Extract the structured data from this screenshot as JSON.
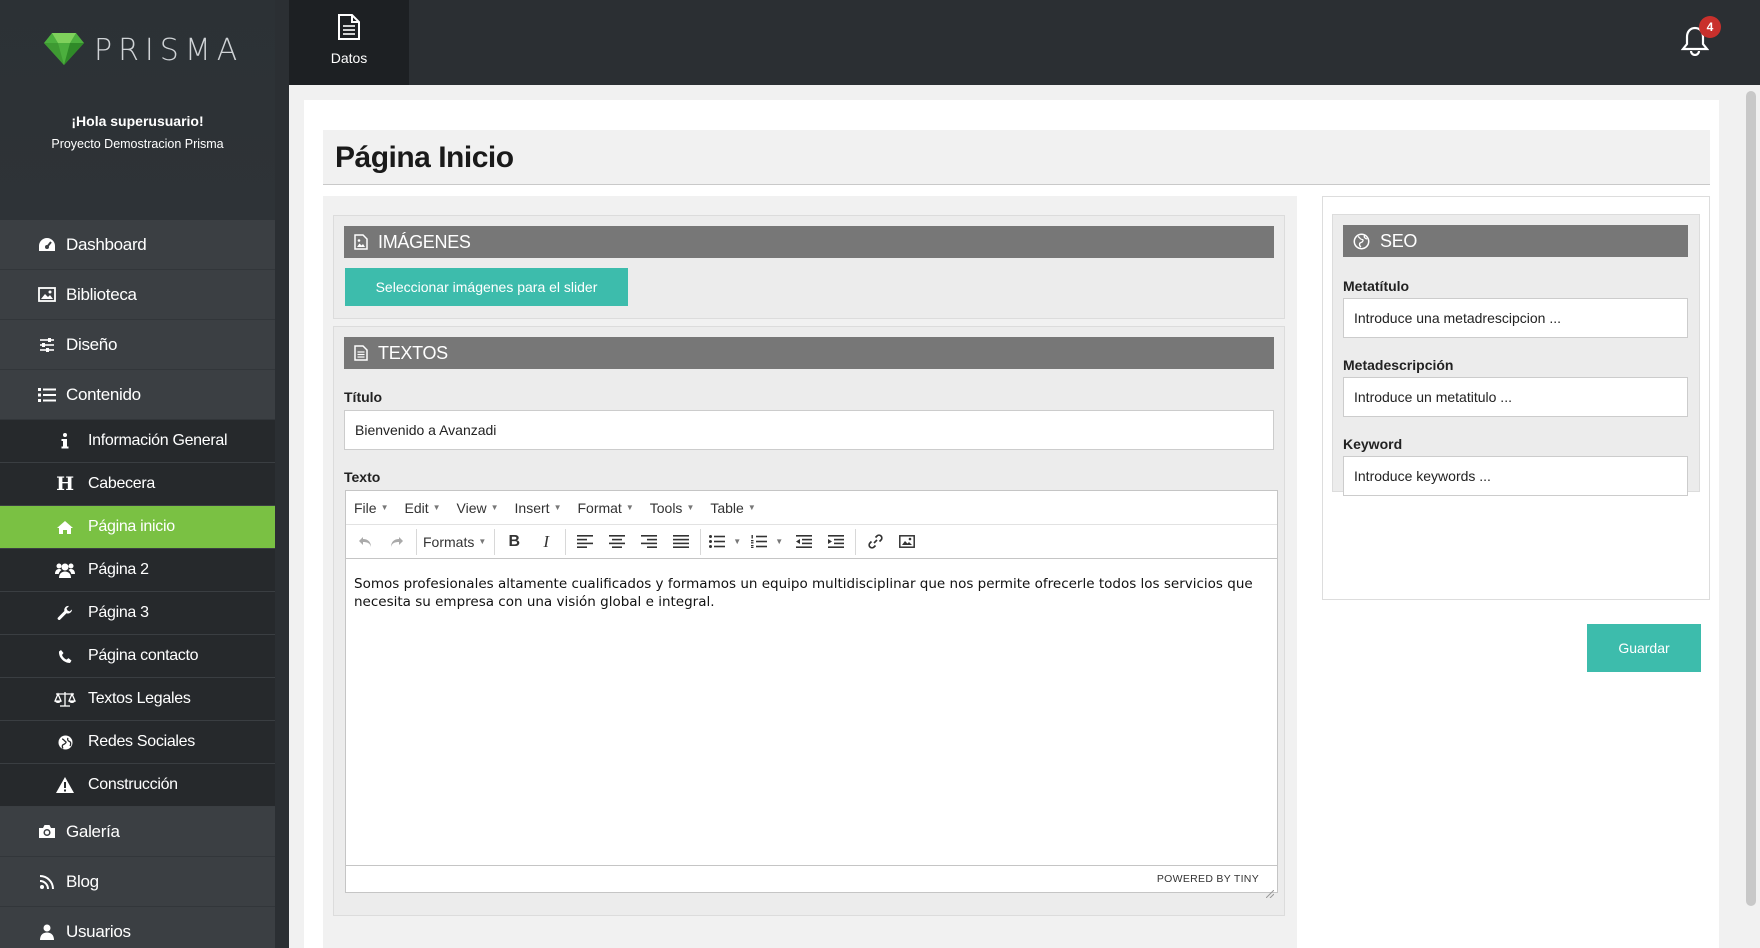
{
  "brand": {
    "name": "PRISMA"
  },
  "user": {
    "greeting": "¡Hola superusuario!",
    "project": "Proyecto Demostracion Prisma"
  },
  "sidebar": {
    "items": [
      {
        "label": "Dashboard",
        "icon": "dashboard-icon"
      },
      {
        "label": "Biblioteca",
        "icon": "image-icon"
      },
      {
        "label": "Diseño",
        "icon": "sliders-icon"
      },
      {
        "label": "Contenido",
        "icon": "list-icon"
      }
    ],
    "subitems": [
      {
        "label": "Información General",
        "icon": "info-icon"
      },
      {
        "label": "Cabecera",
        "icon": "header-icon"
      },
      {
        "label": "Página inicio",
        "icon": "home-icon",
        "active": true
      },
      {
        "label": "Página 2",
        "icon": "users-icon"
      },
      {
        "label": "Página 3",
        "icon": "wrench-icon"
      },
      {
        "label": "Página contacto",
        "icon": "phone-icon"
      },
      {
        "label": "Textos Legales",
        "icon": "scale-icon"
      },
      {
        "label": "Redes Sociales",
        "icon": "globe-icon"
      },
      {
        "label": "Construcción",
        "icon": "warning-icon"
      }
    ],
    "bottom_items": [
      {
        "label": "Galería",
        "icon": "camera-icon"
      },
      {
        "label": "Blog",
        "icon": "rss-icon"
      },
      {
        "label": "Usuarios",
        "icon": "user-icon"
      }
    ],
    "active_color": "#7ac143"
  },
  "topbar": {
    "tab_label": "Datos",
    "notifications_count": "4"
  },
  "page": {
    "title": "Página Inicio"
  },
  "imagenes": {
    "heading": "IMÁGENES",
    "button_label": "Seleccionar imágenes para el slider"
  },
  "textos": {
    "heading": "TEXTOS",
    "titulo_label": "Título",
    "titulo_value": "Bienvenido a Avanzadi",
    "texto_label": "Texto",
    "editor": {
      "menu": [
        "File",
        "Edit",
        "View",
        "Insert",
        "Format",
        "Tools",
        "Table"
      ],
      "formats_label": "Formats",
      "content": "Somos profesionales altamente cualificados y formamos un equipo multidisciplinar que nos permite ofrecerle todos los servicios que necesita su empresa con una visión global e integral.",
      "status": "POWERED BY TINY"
    }
  },
  "seo": {
    "heading": "SEO",
    "metatitulo_label": "Metatítulo",
    "metatitulo_placeholder": "Introduce una metadrescipcion ...",
    "metadescripcion_label": "Metadescripción",
    "metadescripcion_placeholder": "Introduce un metatitulo ...",
    "keyword_label": "Keyword",
    "keyword_placeholder": "Introduce keywords ...",
    "save_label": "Guardar"
  },
  "colors": {
    "accent": "#3dbcac",
    "panel_header": "#777777",
    "badge": "#c9302c"
  }
}
